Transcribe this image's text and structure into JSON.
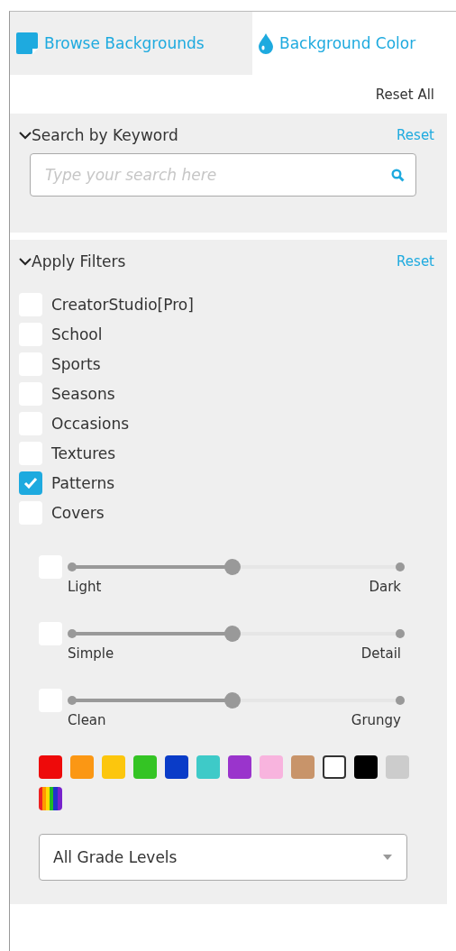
{
  "tabs": [
    {
      "label": "Browse Backgrounds",
      "selected": false
    },
    {
      "label": "Background Color",
      "selected": true
    }
  ],
  "reset_all": "Reset All",
  "search_section": {
    "title": "Search by Keyword",
    "reset": "Reset",
    "search": {
      "placeholder": "Type your search here"
    }
  },
  "filters_section": {
    "title": "Apply Filters",
    "reset": "Reset",
    "categories": [
      {
        "label": "CreatorStudio[Pro]",
        "checked": false
      },
      {
        "label": "School",
        "checked": false
      },
      {
        "label": "Sports",
        "checked": false
      },
      {
        "label": "Seasons",
        "checked": false
      },
      {
        "label": "Occasions",
        "checked": false
      },
      {
        "label": "Textures",
        "checked": false
      },
      {
        "label": "Patterns",
        "checked": true
      },
      {
        "label": "Covers",
        "checked": false
      }
    ],
    "sliders": [
      {
        "checked": false,
        "level": 0.49,
        "min_label": "Light",
        "max_label": "Dark"
      },
      {
        "checked": false,
        "level": 0.49,
        "min_label": "Simple",
        "max_label": "Detail"
      },
      {
        "checked": false,
        "level": 0.49,
        "min_label": "Clean",
        "max_label": "Grungy"
      }
    ],
    "swatches": [
      {
        "kind": "solid",
        "color": "#ee0a0a"
      },
      {
        "kind": "solid",
        "color": "#fb9714"
      },
      {
        "kind": "solid",
        "color": "#fcc60d"
      },
      {
        "kind": "solid",
        "color": "#34c424"
      },
      {
        "kind": "solid",
        "color": "#0a3cc8"
      },
      {
        "kind": "solid",
        "color": "#3ecac8"
      },
      {
        "kind": "solid",
        "color": "#9a34cc"
      },
      {
        "kind": "solid",
        "color": "#f8b4de"
      },
      {
        "kind": "solid",
        "color": "#c8946a"
      },
      {
        "kind": "solid",
        "color": "#ffffff"
      },
      {
        "kind": "solid",
        "color": "#000000"
      },
      {
        "kind": "solid",
        "color": "#cccccc"
      },
      {
        "kind": "rainbow"
      }
    ],
    "grade_select": {
      "value": "All Grade Levels"
    }
  }
}
